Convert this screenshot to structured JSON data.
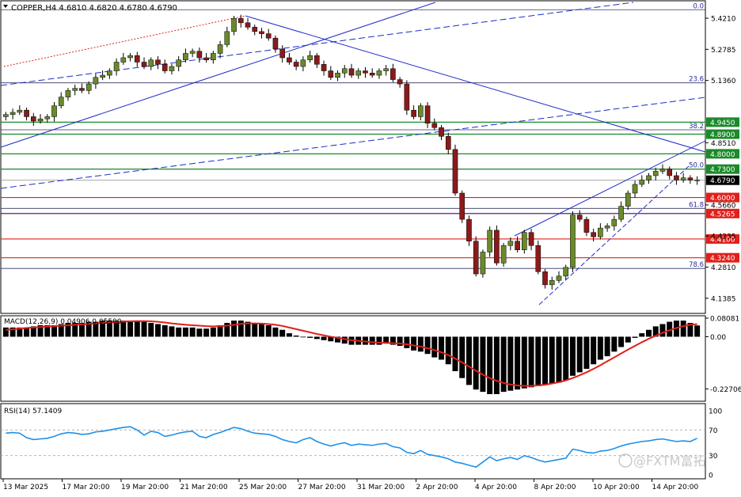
{
  "header": {
    "symbol_line": "COPPER,H4  4.6810 4.6820 4.6780 4.6790"
  },
  "colors": {
    "bull": "#6a8a2a",
    "bear": "#8b1a1a",
    "trend": "#1c2cc8",
    "support": "#e0201a",
    "resistance": "#1a8a2a",
    "fib": "#2a2aa0",
    "macd_signal": "#e0201a",
    "rsi": "#1e90e8",
    "price_tag": "#000000"
  },
  "chart_data": [
    {
      "type": "candlestick",
      "panel": "price",
      "ylim": [
        4.08,
        5.49
      ],
      "y_ticks": [
        "5.4210",
        "5.2785",
        "5.1360",
        "4.8510",
        "4.5660",
        "4.4235",
        "4.2810",
        "4.1385"
      ],
      "x_ticks": [
        "13 Mar 2025",
        "17 Mar 20:00",
        "19 Mar 20:00",
        "21 Mar 20:00",
        "25 Mar 20:00",
        "27 Mar 20:00",
        "31 Mar 20:00",
        "2 Apr 20:00",
        "4 Apr 20:00",
        "8 Apr 20:00",
        "10 Apr 20:00",
        "14 Apr 20:00"
      ],
      "close_series": [
        4.98,
        4.99,
        5.0,
        4.97,
        4.95,
        4.96,
        4.97,
        5.02,
        5.06,
        5.09,
        5.1,
        5.09,
        5.12,
        5.15,
        5.16,
        5.18,
        5.22,
        5.24,
        5.25,
        5.22,
        5.2,
        5.23,
        5.21,
        5.18,
        5.2,
        5.23,
        5.26,
        5.27,
        5.24,
        5.23,
        5.26,
        5.3,
        5.36,
        5.42,
        5.4,
        5.38,
        5.36,
        5.35,
        5.33,
        5.28,
        5.24,
        5.22,
        5.2,
        5.23,
        5.25,
        5.21,
        5.18,
        5.15,
        5.17,
        5.19,
        5.16,
        5.18,
        5.17,
        5.16,
        5.18,
        5.19,
        5.14,
        5.12,
        5.0,
        4.97,
        5.02,
        4.94,
        4.92,
        4.88,
        4.82,
        4.62,
        4.5,
        4.4,
        4.25,
        4.35,
        4.45,
        4.3,
        4.38,
        4.4,
        4.36,
        4.44,
        4.38,
        4.26,
        4.2,
        4.22,
        4.24,
        4.28,
        4.52,
        4.5,
        4.44,
        4.42,
        4.46,
        4.47,
        4.5,
        4.56,
        4.62,
        4.66,
        4.68,
        4.7,
        4.72,
        4.73,
        4.7,
        4.68,
        4.69,
        4.68,
        4.68
      ],
      "last_price": "4.6790"
    },
    {
      "type": "line",
      "panel": "macd",
      "title": "MACD(12,26,9) 0.04906 0.05500",
      "ylim": [
        -0.2706,
        0.0808
      ],
      "y_ticks": [
        "0.08081",
        "0.00",
        "-0.22706"
      ],
      "histogram": [
        0.04,
        0.04,
        0.04,
        0.04,
        0.045,
        0.05,
        0.05,
        0.05,
        0.055,
        0.06,
        0.06,
        0.06,
        0.065,
        0.065,
        0.07,
        0.07,
        0.07,
        0.07,
        0.07,
        0.068,
        0.065,
        0.06,
        0.055,
        0.05,
        0.045,
        0.04,
        0.04,
        0.04,
        0.035,
        0.035,
        0.04,
        0.05,
        0.06,
        0.07,
        0.07,
        0.065,
        0.06,
        0.055,
        0.05,
        0.04,
        0.03,
        0.015,
        0.005,
        0.0,
        -0.005,
        -0.01,
        -0.015,
        -0.02,
        -0.025,
        -0.03,
        -0.035,
        -0.035,
        -0.035,
        -0.035,
        -0.035,
        -0.03,
        -0.035,
        -0.04,
        -0.05,
        -0.06,
        -0.065,
        -0.075,
        -0.09,
        -0.1,
        -0.12,
        -0.15,
        -0.18,
        -0.21,
        -0.23,
        -0.24,
        -0.25,
        -0.25,
        -0.24,
        -0.235,
        -0.23,
        -0.225,
        -0.22,
        -0.215,
        -0.21,
        -0.205,
        -0.2,
        -0.19,
        -0.17,
        -0.155,
        -0.14,
        -0.12,
        -0.1,
        -0.085,
        -0.065,
        -0.045,
        -0.025,
        -0.005,
        0.015,
        0.03,
        0.045,
        0.055,
        0.065,
        0.07,
        0.07,
        0.06,
        0.049
      ],
      "signal": [
        0.03,
        0.032,
        0.035,
        0.038,
        0.04,
        0.042,
        0.044,
        0.046,
        0.048,
        0.05,
        0.052,
        0.054,
        0.056,
        0.058,
        0.06,
        0.062,
        0.064,
        0.066,
        0.067,
        0.068,
        0.068,
        0.067,
        0.065,
        0.062,
        0.058,
        0.055,
        0.052,
        0.05,
        0.048,
        0.046,
        0.045,
        0.046,
        0.048,
        0.052,
        0.056,
        0.058,
        0.058,
        0.057,
        0.055,
        0.052,
        0.047,
        0.04,
        0.033,
        0.026,
        0.019,
        0.012,
        0.006,
        0.0,
        -0.005,
        -0.01,
        -0.015,
        -0.018,
        -0.021,
        -0.024,
        -0.026,
        -0.027,
        -0.028,
        -0.03,
        -0.033,
        -0.038,
        -0.043,
        -0.05,
        -0.058,
        -0.068,
        -0.08,
        -0.095,
        -0.112,
        -0.13,
        -0.148,
        -0.165,
        -0.18,
        -0.192,
        -0.201,
        -0.208,
        -0.212,
        -0.214,
        -0.214,
        -0.212,
        -0.209,
        -0.204,
        -0.198,
        -0.19,
        -0.18,
        -0.168,
        -0.155,
        -0.14,
        -0.124,
        -0.107,
        -0.09,
        -0.073,
        -0.056,
        -0.04,
        -0.024,
        -0.009,
        0.004,
        0.017,
        0.028,
        0.038,
        0.046,
        0.052,
        0.055
      ]
    },
    {
      "type": "line",
      "panel": "rsi",
      "title": "RSI(14) 57.1409",
      "ylim": [
        0,
        100
      ],
      "y_ticks": [
        "100",
        "70",
        "30",
        "0"
      ],
      "levels": [
        70,
        30
      ],
      "values": [
        65,
        66,
        65,
        58,
        55,
        56,
        57,
        60,
        64,
        66,
        65,
        63,
        64,
        67,
        68,
        70,
        72,
        74,
        75,
        70,
        62,
        68,
        66,
        60,
        62,
        65,
        67,
        68,
        60,
        58,
        63,
        66,
        70,
        74,
        72,
        68,
        65,
        64,
        63,
        60,
        55,
        52,
        50,
        55,
        58,
        52,
        48,
        45,
        48,
        50,
        46,
        48,
        47,
        46,
        48,
        49,
        44,
        42,
        35,
        33,
        38,
        32,
        30,
        28,
        25,
        20,
        18,
        15,
        12,
        20,
        28,
        22,
        25,
        27,
        24,
        30,
        27,
        23,
        20,
        22,
        24,
        26,
        40,
        38,
        35,
        34,
        37,
        38,
        41,
        45,
        48,
        50,
        52,
        53,
        55,
        56,
        54,
        52,
        53,
        52,
        57
      ]
    }
  ],
  "levels": {
    "red": [
      {
        "label": "4.6000",
        "value": 4.6
      },
      {
        "label": "4.5265",
        "value": 4.5265
      },
      {
        "label": "4.4100",
        "value": 4.41
      },
      {
        "label": "4.3240",
        "value": 4.324
      }
    ],
    "green": [
      {
        "label": "4.9450",
        "value": 4.945
      },
      {
        "label": "4.8900",
        "value": 4.89
      },
      {
        "label": "4.8000",
        "value": 4.8
      },
      {
        "label": "4.7300",
        "value": 4.73
      }
    ],
    "fib": [
      {
        "label": "0.0",
        "value": 5.46
      },
      {
        "label": "23.6",
        "value": 5.125
      },
      {
        "label": "38.2",
        "value": 4.91
      },
      {
        "label": "50.0",
        "value": 4.73
      },
      {
        "label": "61.8",
        "value": 4.55
      },
      {
        "label": "78.6",
        "value": 4.275
      }
    ]
  },
  "watermark": "@FXTM富拓"
}
